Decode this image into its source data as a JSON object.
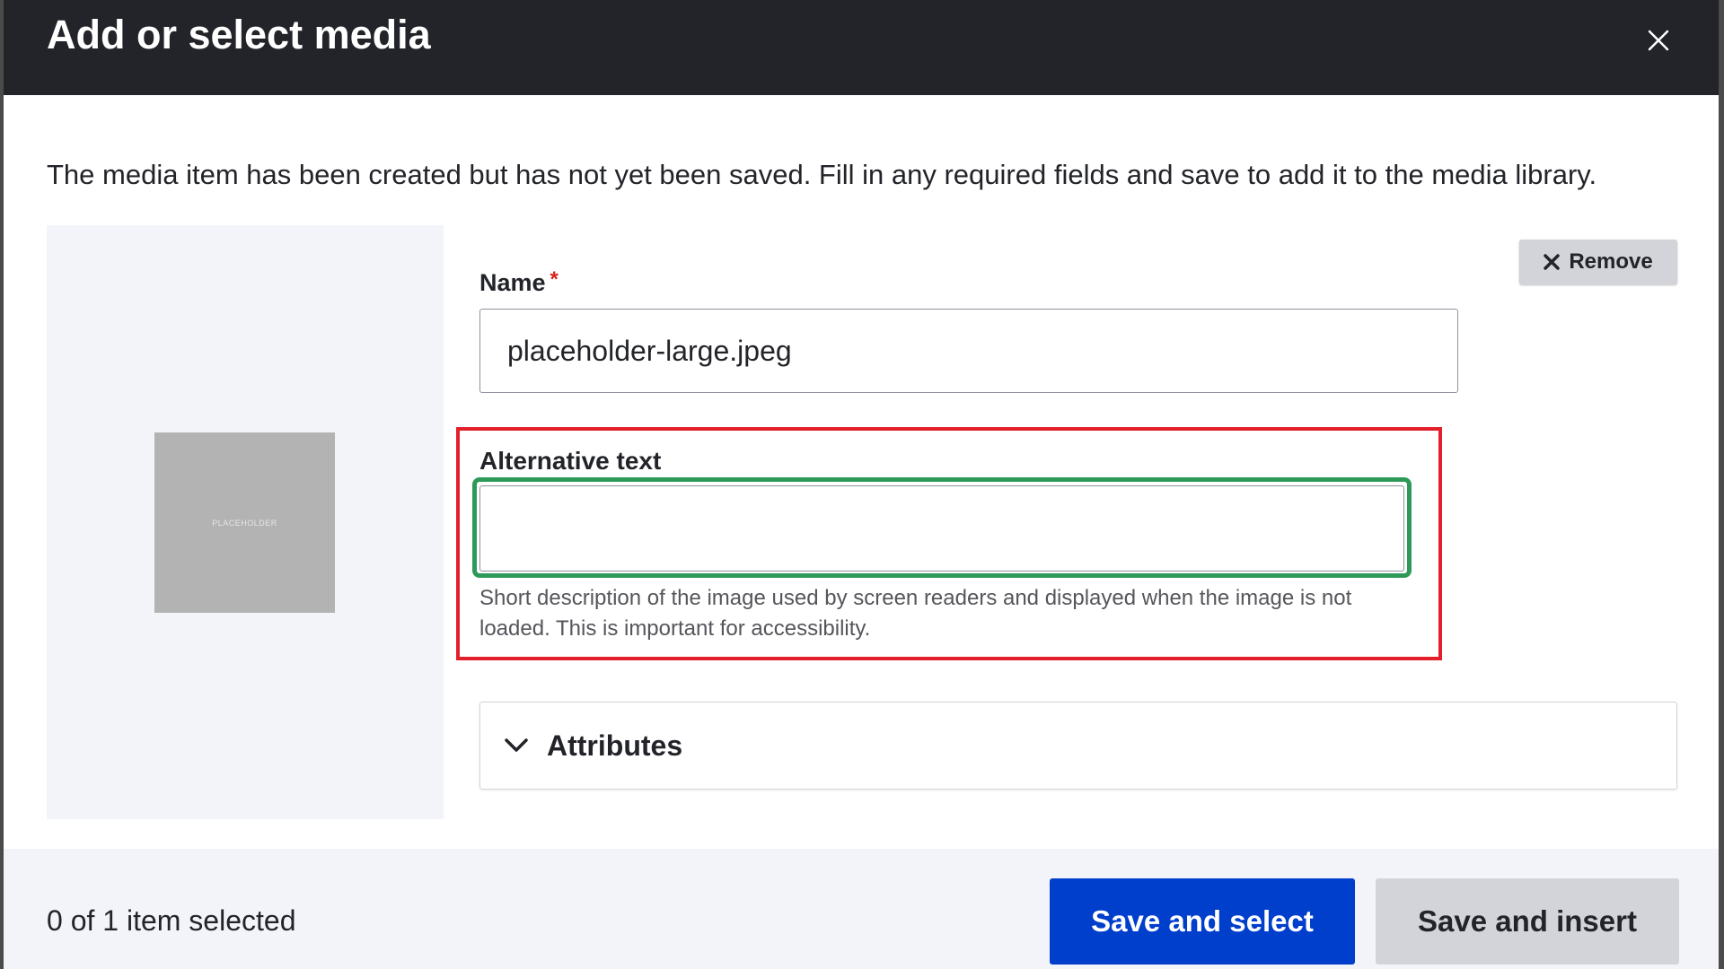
{
  "dialog": {
    "title": "Add or select media",
    "close_icon": "close-icon"
  },
  "message": "The media item has been created but has not yet been saved. Fill in any required fields and save to add it to the media library.",
  "preview": {
    "thumbnail_text": "PLACEHOLDER"
  },
  "remove": {
    "label": "Remove",
    "icon": "x-icon"
  },
  "name_field": {
    "label": "Name",
    "required_marker": "*",
    "value": "placeholder-large.jpeg"
  },
  "alt_field": {
    "label": "Alternative text",
    "value": "",
    "description": "Short description of the image used by screen readers and displayed when the image is not loaded. This is important for accessibility."
  },
  "attributes": {
    "label": "Attributes",
    "icon": "chevron-down-icon"
  },
  "footer": {
    "selected_count": "0 of 1 item selected",
    "save_select_label": "Save and select",
    "save_insert_label": "Save and insert"
  },
  "colors": {
    "title_bar": "#232429",
    "primary_button": "#003ecc",
    "required": "#d72222",
    "highlight_red": "#e3202a",
    "highlight_green": "#2e9a5a"
  }
}
